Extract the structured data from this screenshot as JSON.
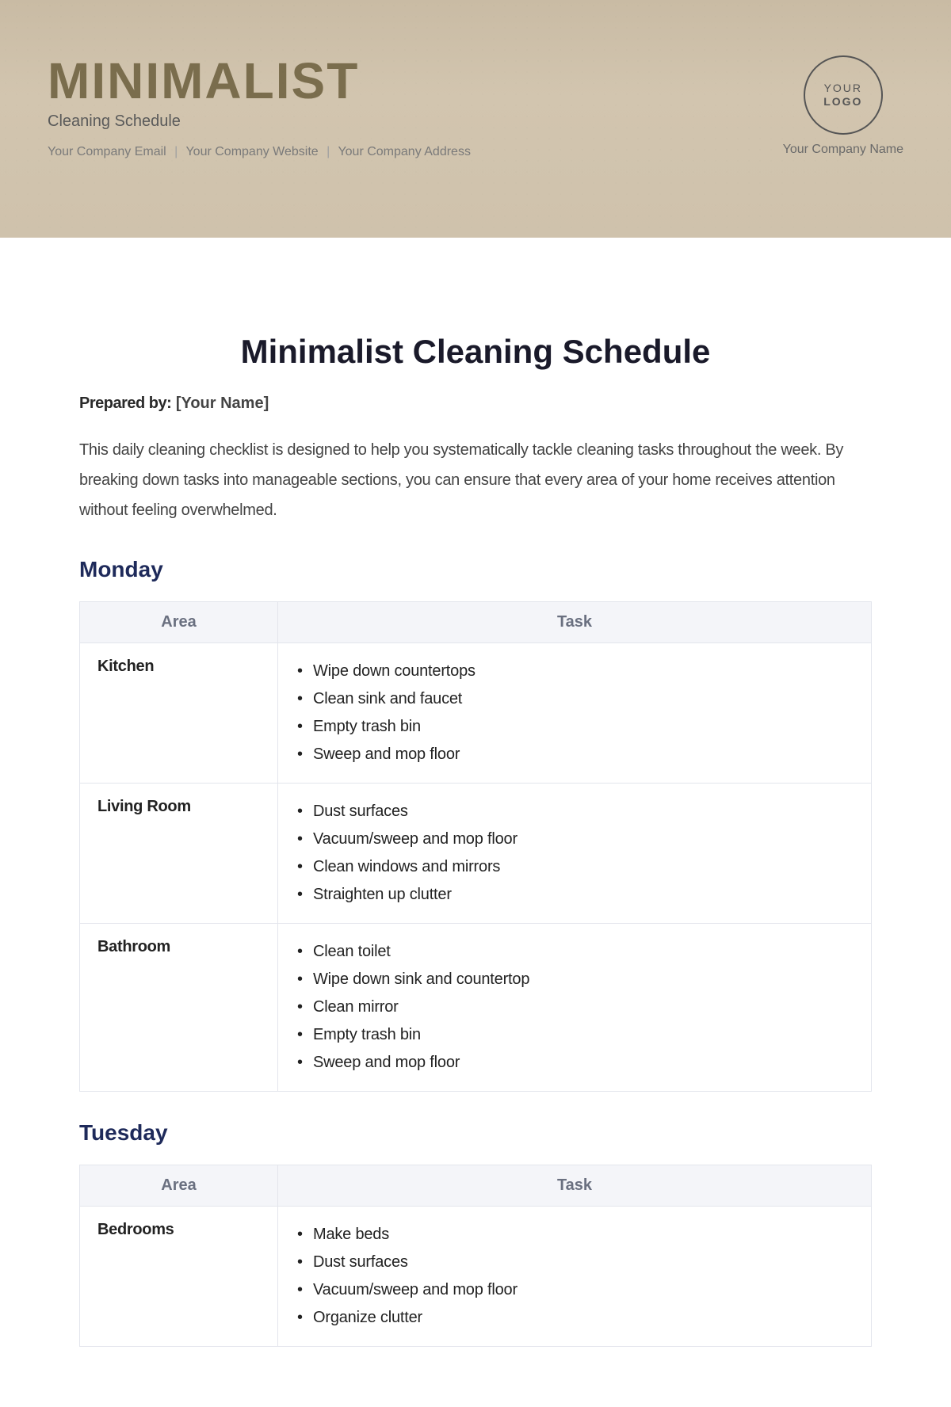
{
  "banner": {
    "title": "MINIMALIST",
    "subtitle": "Cleaning Schedule",
    "contact": {
      "email": "Your Company Email",
      "website": "Your Company Website",
      "address": "Your Company Address"
    },
    "logo": {
      "line1": "YOUR",
      "line2": "LOGO"
    },
    "company_name": "Your Company Name"
  },
  "doc": {
    "title": "Minimalist Cleaning Schedule",
    "prepared_label": "Prepared by:",
    "prepared_value": "[Your Name]",
    "intro": "This daily cleaning checklist is designed to help you systematically tackle cleaning tasks throughout the week. By breaking down tasks into manageable sections, you can ensure that every area of your home receives attention without feeling overwhelmed."
  },
  "table_headers": {
    "area": "Area",
    "task": "Task"
  },
  "days": [
    {
      "name": "Monday",
      "rows": [
        {
          "area": "Kitchen",
          "tasks": [
            "Wipe down countertops",
            "Clean sink and faucet",
            "Empty trash bin",
            "Sweep and mop floor"
          ]
        },
        {
          "area": "Living Room",
          "tasks": [
            "Dust surfaces",
            "Vacuum/sweep and mop floor",
            "Clean windows and mirrors",
            "Straighten up clutter"
          ]
        },
        {
          "area": "Bathroom",
          "tasks": [
            "Clean toilet",
            "Wipe down sink and countertop",
            "Clean mirror",
            "Empty trash bin",
            "Sweep and mop floor"
          ]
        }
      ]
    },
    {
      "name": "Tuesday",
      "rows": [
        {
          "area": "Bedrooms",
          "tasks": [
            "Make beds",
            "Dust surfaces",
            "Vacuum/sweep and mop floor",
            "Organize clutter"
          ]
        }
      ]
    }
  ]
}
